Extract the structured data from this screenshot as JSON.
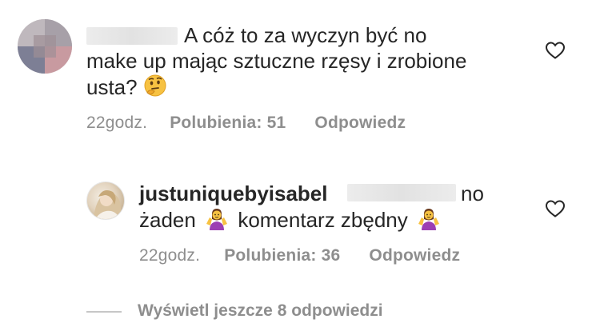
{
  "comment": {
    "text_line1": "A cóż to za wyczyn być no",
    "text_line2": "make up mając sztuczne rzęsy i zrobione",
    "text_line3": "usta?",
    "emoji": "thinking-face",
    "time": "22godz.",
    "likes": "Polubienia: 51",
    "reply_label": "Odpowiedz"
  },
  "reply": {
    "username": "justuniquebyisabel",
    "text_line1_tail": "no",
    "text_line2_a": "żaden",
    "text_line2_b": "komentarz zbędny",
    "emoji": "person-shrugging",
    "time": "22godz.",
    "likes": "Polubienia: 36",
    "reply_label": "Odpowiedz"
  },
  "view_more": {
    "label": "Wyświetl jeszcze 8 odpowiedzi"
  },
  "icons": {
    "like": "heart-outline-icon",
    "accent": "#8e8e8e"
  }
}
